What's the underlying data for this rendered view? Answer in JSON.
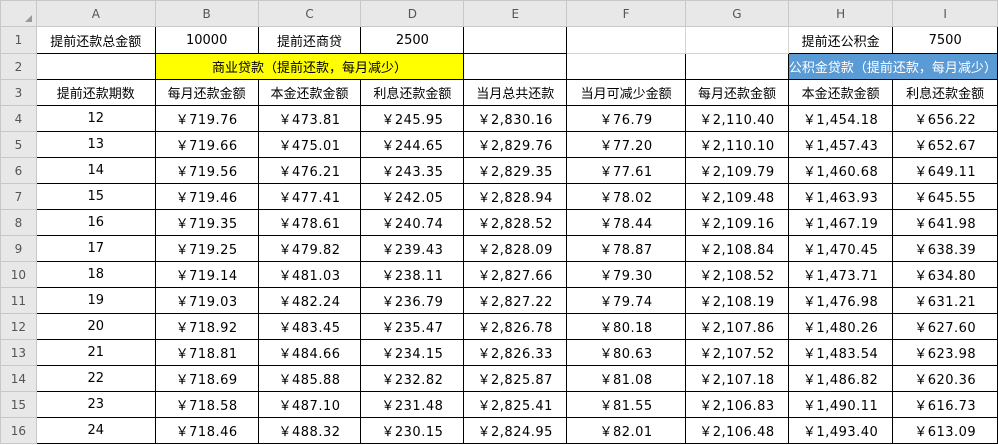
{
  "columns": [
    "A",
    "B",
    "C",
    "D",
    "E",
    "F",
    "G",
    "H",
    "I"
  ],
  "row_numbers": [
    "1",
    "2",
    "3",
    "4",
    "5",
    "6",
    "7",
    "8",
    "9",
    "10",
    "11",
    "12",
    "13",
    "14",
    "15",
    "16"
  ],
  "row1": {
    "a_label": "提前还款总金额",
    "b_value": "10000",
    "c_label": "提前还商贷",
    "d_value": "2500",
    "h_label": "提前还公积金",
    "i_value": "7500"
  },
  "row2": {
    "commercial_title": "商业贷款（提前还款，每月减少）",
    "fund_title": "公积金贷款（提前还款，每月减少）"
  },
  "headers": [
    "提前还款期数",
    "每月还款金额",
    "本金还款金额",
    "利息还款金额",
    "当月总共还款",
    "当月可减少金额",
    "每月还款金额",
    "本金还款金额",
    "利息还款金额"
  ],
  "rows": [
    [
      "12",
      "￥719.76",
      "￥473.81",
      "￥245.95",
      "￥2,830.16",
      "￥76.79",
      "￥2,110.40",
      "￥1,454.18",
      "￥656.22"
    ],
    [
      "13",
      "￥719.66",
      "￥475.01",
      "￥244.65",
      "￥2,829.76",
      "￥77.20",
      "￥2,110.10",
      "￥1,457.43",
      "￥652.67"
    ],
    [
      "14",
      "￥719.56",
      "￥476.21",
      "￥243.35",
      "￥2,829.35",
      "￥77.61",
      "￥2,109.79",
      "￥1,460.68",
      "￥649.11"
    ],
    [
      "15",
      "￥719.46",
      "￥477.41",
      "￥242.05",
      "￥2,828.94",
      "￥78.02",
      "￥2,109.48",
      "￥1,463.93",
      "￥645.55"
    ],
    [
      "16",
      "￥719.35",
      "￥478.61",
      "￥240.74",
      "￥2,828.52",
      "￥78.44",
      "￥2,109.16",
      "￥1,467.19",
      "￥641.98"
    ],
    [
      "17",
      "￥719.25",
      "￥479.82",
      "￥239.43",
      "￥2,828.09",
      "￥78.87",
      "￥2,108.84",
      "￥1,470.45",
      "￥638.39"
    ],
    [
      "18",
      "￥719.14",
      "￥481.03",
      "￥238.11",
      "￥2,827.66",
      "￥79.30",
      "￥2,108.52",
      "￥1,473.71",
      "￥634.80"
    ],
    [
      "19",
      "￥719.03",
      "￥482.24",
      "￥236.79",
      "￥2,827.22",
      "￥79.74",
      "￥2,108.19",
      "￥1,476.98",
      "￥631.21"
    ],
    [
      "20",
      "￥718.92",
      "￥483.45",
      "￥235.47",
      "￥2,826.78",
      "￥80.18",
      "￥2,107.86",
      "￥1,480.26",
      "￥627.60"
    ],
    [
      "21",
      "￥718.81",
      "￥484.66",
      "￥234.15",
      "￥2,826.33",
      "￥80.63",
      "￥2,107.52",
      "￥1,483.54",
      "￥623.98"
    ],
    [
      "22",
      "￥718.69",
      "￥485.88",
      "￥232.82",
      "￥2,825.87",
      "￥81.08",
      "￥2,107.18",
      "￥1,486.82",
      "￥620.36"
    ],
    [
      "23",
      "￥718.58",
      "￥487.10",
      "￥231.48",
      "￥2,825.41",
      "￥81.55",
      "￥2,106.83",
      "￥1,490.11",
      "￥616.73"
    ],
    [
      "24",
      "￥718.46",
      "￥488.32",
      "￥230.15",
      "￥2,824.95",
      "￥82.01",
      "￥2,106.48",
      "￥1,493.40",
      "￥613.09"
    ]
  ],
  "colors": {
    "yellow": "#ffff00",
    "blue": "#5b9bd5",
    "header_gray": "#e8e8e8"
  }
}
